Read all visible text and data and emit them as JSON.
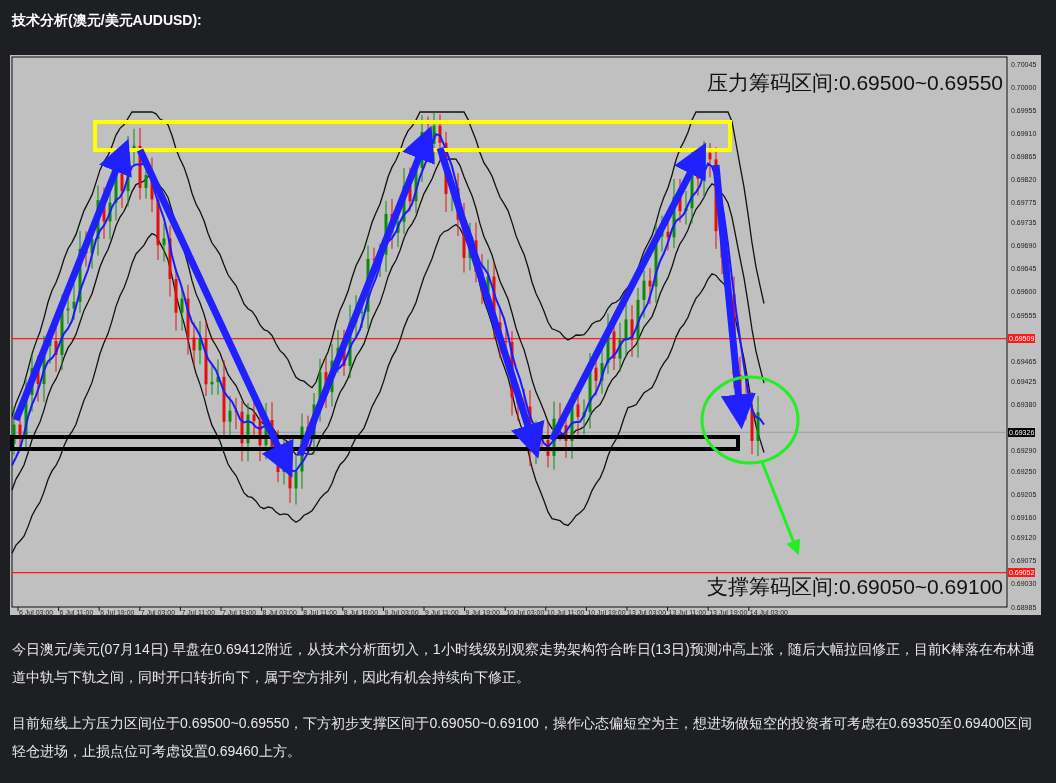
{
  "heading": "技术分析(澳元/美元AUDUSD):",
  "chart": {
    "price_labels": [
      {
        "text": "0.70045",
        "kind": "tick"
      },
      {
        "text": "0.70000",
        "kind": "tick"
      },
      {
        "text": "0.69955",
        "kind": "tick"
      },
      {
        "text": "0.69910",
        "kind": "tick"
      },
      {
        "text": "0.69865",
        "kind": "tick"
      },
      {
        "text": "0.69820",
        "kind": "tick"
      },
      {
        "text": "0.69775",
        "kind": "tick"
      },
      {
        "text": "0.69735",
        "kind": "tick"
      },
      {
        "text": "0.69690",
        "kind": "tick"
      },
      {
        "text": "0.69645",
        "kind": "tick"
      },
      {
        "text": "0.69600",
        "kind": "tick"
      },
      {
        "text": "0.69555",
        "kind": "tick"
      },
      {
        "text": "0.69509",
        "kind": "line"
      },
      {
        "text": "0.69465",
        "kind": "tick"
      },
      {
        "text": "0.69425",
        "kind": "tick"
      },
      {
        "text": "0.69380",
        "kind": "tick"
      },
      {
        "text": "0.69326",
        "kind": "current"
      },
      {
        "text": "0.69290",
        "kind": "tick"
      },
      {
        "text": "0.69250",
        "kind": "tick"
      },
      {
        "text": "0.69205",
        "kind": "tick"
      },
      {
        "text": "0.69160",
        "kind": "tick"
      },
      {
        "text": "0.69120",
        "kind": "tick"
      },
      {
        "text": "0.69075",
        "kind": "tick"
      },
      {
        "text": "0.69052",
        "kind": "line"
      },
      {
        "text": "0.69030",
        "kind": "tick"
      },
      {
        "text": "0.68985",
        "kind": "tick"
      }
    ],
    "time_labels": [
      "6 Jul 03:00",
      "6 Jul 11:00",
      "6 Jul 19:00",
      "7 Jul 03:00",
      "7 Jul 11:00",
      "7 Jul 19:00",
      "8 Jul 03:00",
      "8 Jul 11:00",
      "8 Jul 19:00",
      "9 Jul 03:00",
      "9 Jul 11:00",
      "9 Jul 19:00",
      "10 Jul 03:00",
      "10 Jul 11:00",
      "10 Jul 19:00",
      "13 Jul 03:00",
      "13 Jul 11:00",
      "13 Jul 19:00",
      "14 Jul 03:00"
    ],
    "annotations": [
      {
        "text": "压力筹码区间:0.69500~0.69550",
        "kind": "resistance"
      },
      {
        "text": "支撑筹码区间:0.69050~0.69100",
        "kind": "support"
      }
    ]
  },
  "paragraphs": [
    "今日澳元/美元(07月14日) 早盘在0.69412附近，从技术分析面切入，1小时线级别观察走势架构符合昨日(13日)预测冲高上涨，随后大幅拉回修正，目前K棒落在布林通道中轨与下轨之间，同时开口转折向下，属于空方排列，因此有机会持续向下修正。",
    "目前短线上方压力区间位于0.69500~0.69550，下方初步支撑区间于0.69050~0.69100，操作心态偏短空为主，想进场做短空的投资者可考虑在0.69350至0.69400区间轻仓进场，止损点位可考虑设置0.69460上方。"
  ]
}
